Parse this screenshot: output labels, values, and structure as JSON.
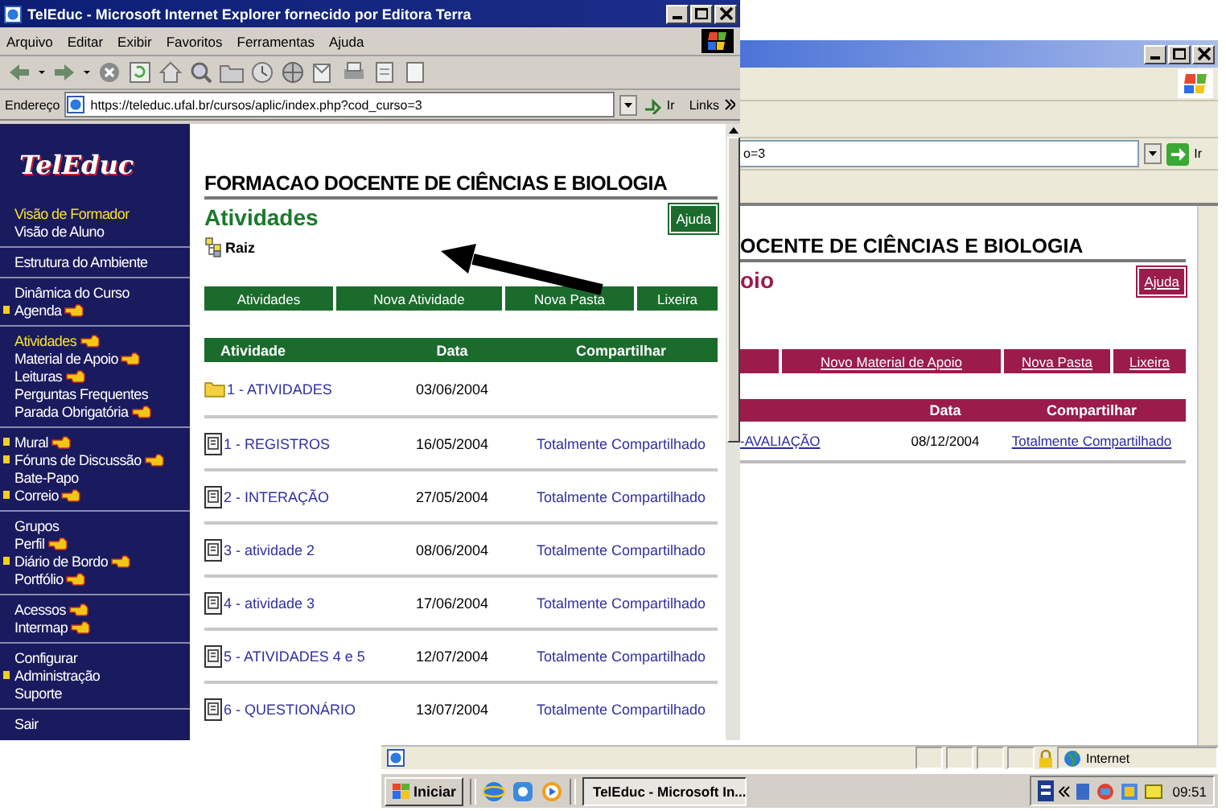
{
  "front_window": {
    "title": "TelEduc - Microsoft Internet Explorer fornecido por Editora Terra",
    "menu": [
      "Arquivo",
      "Editar",
      "Exibir",
      "Favoritos",
      "Ferramentas",
      "Ajuda"
    ],
    "address_label": "Endereço",
    "url": "https://teleduc.ufal.br/cursos/aplic/index.php?cod_curso=3",
    "go": "Ir",
    "links": "Links",
    "sidebar": {
      "logo": "TelEduc",
      "groups": [
        [
          {
            "label": "Visão de Formador",
            "selected": true,
            "marked": false,
            "hand": false
          },
          {
            "label": "Visão de Aluno",
            "selected": false,
            "marked": false,
            "hand": false
          }
        ],
        [
          {
            "label": "Estrutura do Ambiente",
            "selected": false,
            "marked": false,
            "hand": false
          }
        ],
        [
          {
            "label": "Dinâmica do Curso",
            "selected": false,
            "marked": false,
            "hand": false
          },
          {
            "label": "Agenda",
            "selected": false,
            "marked": true,
            "hand": true
          }
        ],
        [
          {
            "label": "Atividades",
            "selected": true,
            "marked": false,
            "hand": true
          },
          {
            "label": "Material de Apoio",
            "selected": false,
            "marked": false,
            "hand": true
          },
          {
            "label": "Leituras",
            "selected": false,
            "marked": false,
            "hand": true
          },
          {
            "label": "Perguntas Frequentes",
            "selected": false,
            "marked": false,
            "hand": false
          },
          {
            "label": "Parada Obrigatória",
            "selected": false,
            "marked": false,
            "hand": true
          }
        ],
        [
          {
            "label": "Mural",
            "selected": false,
            "marked": true,
            "hand": true
          },
          {
            "label": "Fóruns de Discussão",
            "selected": false,
            "marked": true,
            "hand": true
          },
          {
            "label": "Bate-Papo",
            "selected": false,
            "marked": false,
            "hand": false
          },
          {
            "label": "Correio",
            "selected": false,
            "marked": true,
            "hand": true
          }
        ],
        [
          {
            "label": "Grupos",
            "selected": false,
            "marked": false,
            "hand": false
          },
          {
            "label": "Perfil",
            "selected": false,
            "marked": false,
            "hand": true
          },
          {
            "label": "Diário de Bordo",
            "selected": false,
            "marked": true,
            "hand": true
          },
          {
            "label": "Portfólio",
            "selected": false,
            "marked": false,
            "hand": true
          }
        ],
        [
          {
            "label": "Acessos",
            "selected": false,
            "marked": false,
            "hand": true
          },
          {
            "label": "Intermap",
            "selected": false,
            "marked": false,
            "hand": true
          }
        ],
        [
          {
            "label": "Configurar",
            "selected": false,
            "marked": false,
            "hand": false
          },
          {
            "label": "Administração",
            "selected": false,
            "marked": true,
            "hand": false
          },
          {
            "label": "Suporte",
            "selected": false,
            "marked": false,
            "hand": false
          }
        ],
        [
          {
            "label": "Sair",
            "selected": false,
            "marked": false,
            "hand": false
          }
        ]
      ]
    },
    "course_title": "FORMACAO DOCENTE DE CIÊNCIAS E BIOLOGIA",
    "page_title": "Atividades",
    "help": "Ajuda",
    "breadcrumb": "Raiz",
    "actions": [
      "Atividades",
      "Nova Atividade",
      "Nova Pasta",
      "Lixeira"
    ],
    "table": {
      "columns": [
        "Atividade",
        "Data",
        "Compartilhar"
      ],
      "rows": [
        {
          "kind": "folder",
          "name": "1 - ATIVIDADES",
          "date": "03/06/2004"
        },
        {
          "kind": "document",
          "name": "1 - REGISTROS",
          "date": "16/05/2004",
          "share": "Totalmente Compartilhado"
        },
        {
          "kind": "document",
          "name": "2 - INTERAÇÃO",
          "date": "27/05/2004",
          "share": "Totalmente Compartilhado"
        },
        {
          "kind": "document",
          "name": "3 - atividade 2",
          "date": "08/06/2004",
          "share": "Totalmente Compartilhado"
        },
        {
          "kind": "document",
          "name": "4 - atividade 3",
          "date": "17/06/2004",
          "share": "Totalmente Compartilhado"
        },
        {
          "kind": "document",
          "name": "5 - ATIVIDADES 4 e 5",
          "date": "12/07/2004",
          "share": "Totalmente Compartilhado"
        },
        {
          "kind": "document",
          "name": "6 - QUESTIONÁRIO",
          "date": "13/07/2004",
          "share": "Totalmente Compartilhado"
        }
      ]
    }
  },
  "back_window": {
    "address_tail": "o=3",
    "go": "Ir",
    "course_title": "OCENTE DE CIÊNCIAS E BIOLOGIA",
    "page_title": "oio",
    "help": "Ajuda",
    "actions": [
      "Novo Material de Apoio",
      "Nova Pasta",
      "Lixeira"
    ],
    "table": {
      "columns": [
        "Data",
        "Compartilhar"
      ],
      "rows": [
        {
          "name": "-AVALIAÇÃO",
          "date": "08/12/2004",
          "share": "Totalmente Compartilhado"
        }
      ]
    },
    "status_zone": "Internet"
  },
  "taskbar": {
    "start": "Iniciar",
    "task": "TelEduc - Microsoft In...",
    "clock": "09:51"
  }
}
